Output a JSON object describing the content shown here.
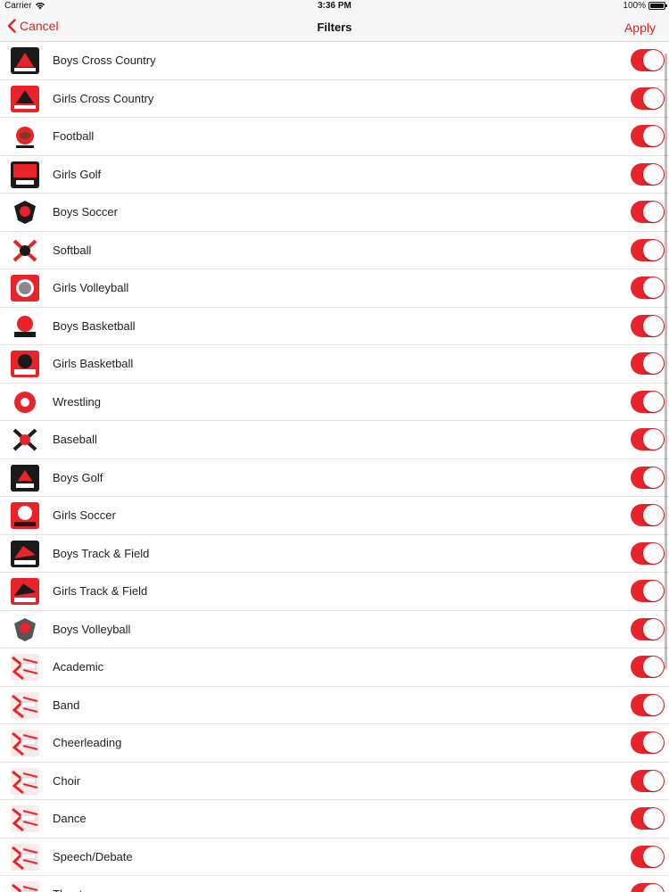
{
  "status_bar": {
    "carrier": "Carrier",
    "time": "3:36 PM",
    "battery": "100%"
  },
  "nav": {
    "cancel_label": "Cancel",
    "title": "Filters",
    "apply_label": "Apply"
  },
  "accent_color": "#e8232a",
  "items": [
    {
      "label": "Boys Cross Country",
      "enabled": true
    },
    {
      "label": "Girls Cross Country",
      "enabled": true
    },
    {
      "label": "Football",
      "enabled": true
    },
    {
      "label": "Girls Golf",
      "enabled": true
    },
    {
      "label": "Boys Soccer",
      "enabled": true
    },
    {
      "label": "Softball",
      "enabled": true
    },
    {
      "label": "Girls Volleyball",
      "enabled": true
    },
    {
      "label": "Boys Basketball",
      "enabled": true
    },
    {
      "label": "Girls Basketball",
      "enabled": true
    },
    {
      "label": "Wrestling",
      "enabled": true
    },
    {
      "label": "Baseball",
      "enabled": true
    },
    {
      "label": "Boys Golf",
      "enabled": true
    },
    {
      "label": "Girls Soccer",
      "enabled": true
    },
    {
      "label": "Boys Track & Field",
      "enabled": true
    },
    {
      "label": "Girls Track & Field",
      "enabled": true
    },
    {
      "label": "Boys Volleyball",
      "enabled": true
    },
    {
      "label": "Academic",
      "enabled": true
    },
    {
      "label": "Band",
      "enabled": true
    },
    {
      "label": "Cheerleading",
      "enabled": true
    },
    {
      "label": "Choir",
      "enabled": true
    },
    {
      "label": "Dance",
      "enabled": true
    },
    {
      "label": "Speech/Debate",
      "enabled": true
    },
    {
      "label": "Theatre",
      "enabled": true
    }
  ]
}
